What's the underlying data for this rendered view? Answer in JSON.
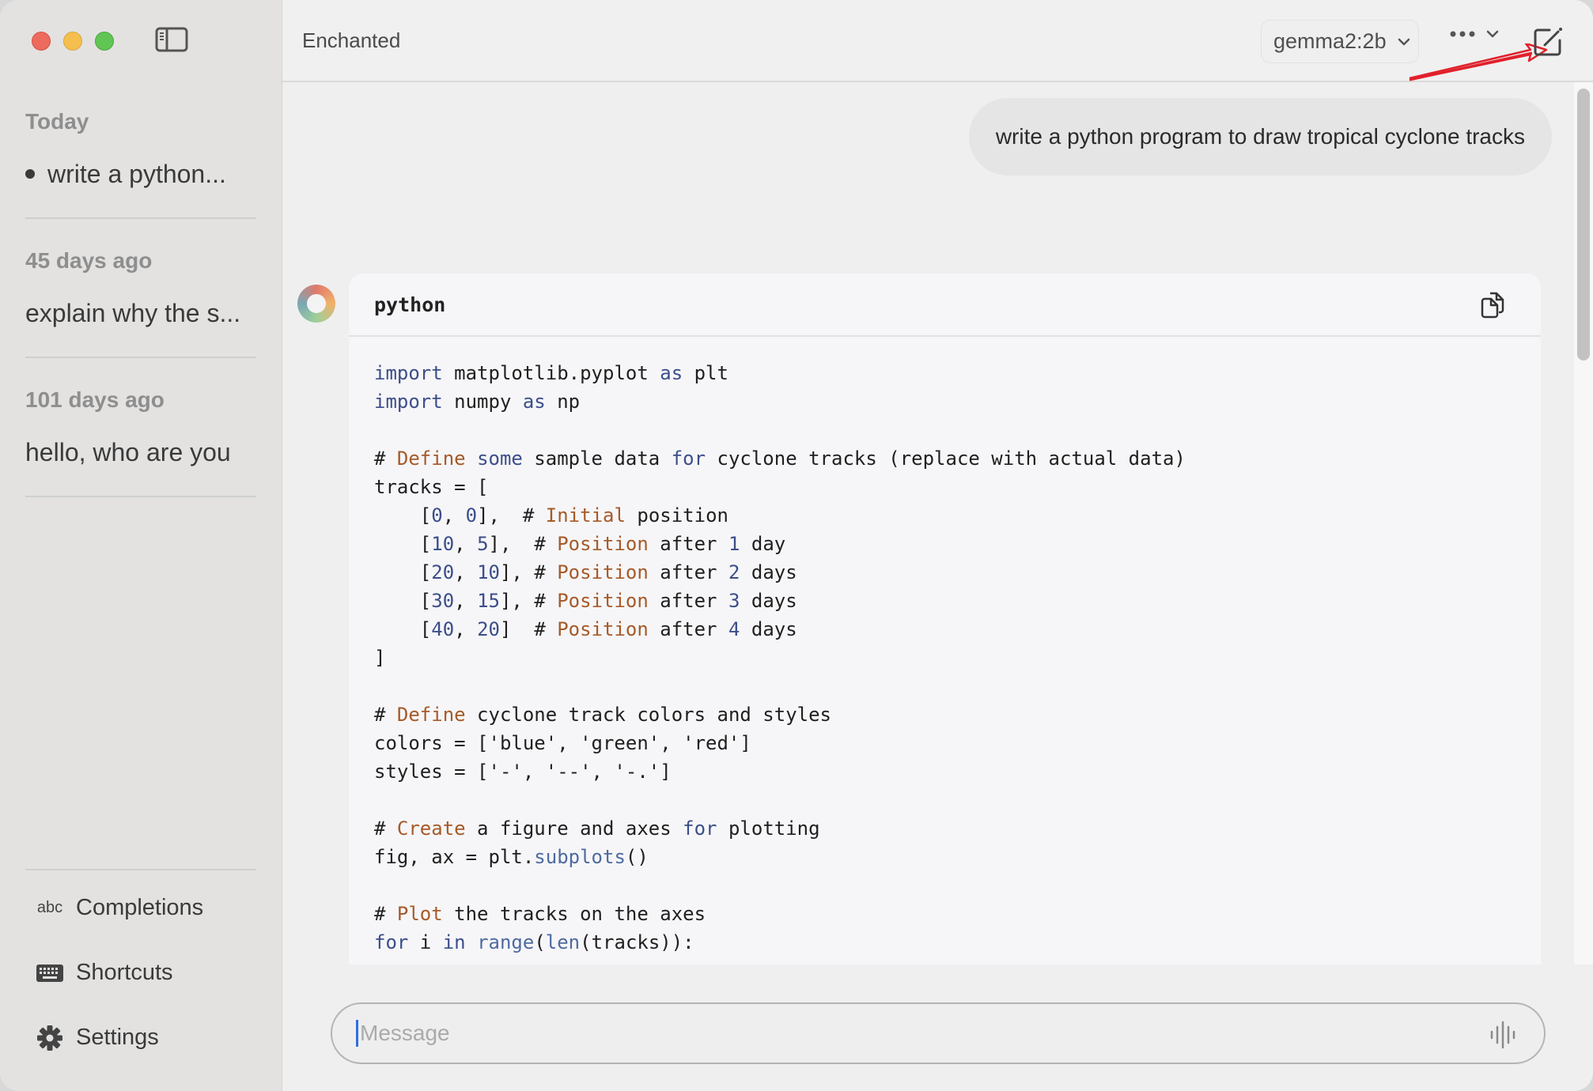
{
  "window": {
    "app_title": "Enchanted"
  },
  "sidebar": {
    "sections": [
      {
        "label": "Today",
        "items": [
          {
            "title": "write a python...",
            "active": true
          }
        ]
      },
      {
        "label": "45 days ago",
        "items": [
          {
            "title": "explain why the s...",
            "active": false
          }
        ]
      },
      {
        "label": "101 days ago",
        "items": [
          {
            "title": "hello, who are you",
            "active": false
          }
        ]
      }
    ],
    "bottom": [
      {
        "label": "Completions",
        "icon": "abc-icon",
        "icon_text": "abc"
      },
      {
        "label": "Shortcuts",
        "icon": "keyboard-icon"
      },
      {
        "label": "Settings",
        "icon": "gear-icon"
      }
    ]
  },
  "header": {
    "model": "gemma2:2b",
    "more_icon": "ellipsis-icon",
    "new_chat_icon": "compose-icon"
  },
  "chat": {
    "user_message": "write a python program to draw tropical cyclone tracks",
    "code_block": {
      "language": "python",
      "copy_icon": "copy-icon",
      "lines": [
        [
          [
            "kw",
            "import"
          ],
          [
            "t",
            " matplotlib.pyplot "
          ],
          [
            "kw",
            "as"
          ],
          [
            "t",
            " plt"
          ]
        ],
        [
          [
            "kw",
            "import"
          ],
          [
            "t",
            " numpy "
          ],
          [
            "kw",
            "as"
          ],
          [
            "t",
            " np"
          ]
        ],
        [],
        [
          [
            "t",
            "# "
          ],
          [
            "cm",
            "Define"
          ],
          [
            "t",
            " "
          ],
          [
            "kw",
            "some"
          ],
          [
            "t",
            " sample data "
          ],
          [
            "kw",
            "for"
          ],
          [
            "t",
            " cyclone tracks (replace with actual data)"
          ]
        ],
        [
          [
            "t",
            "tracks = ["
          ]
        ],
        [
          [
            "t",
            "    ["
          ],
          [
            "nm",
            "0"
          ],
          [
            "t",
            ", "
          ],
          [
            "nm",
            "0"
          ],
          [
            "t",
            "],  # "
          ],
          [
            "cm",
            "Initial"
          ],
          [
            "t",
            " position"
          ]
        ],
        [
          [
            "t",
            "    ["
          ],
          [
            "nm",
            "10"
          ],
          [
            "t",
            ", "
          ],
          [
            "nm",
            "5"
          ],
          [
            "t",
            "],  # "
          ],
          [
            "cm",
            "Position"
          ],
          [
            "t",
            " after "
          ],
          [
            "nm",
            "1"
          ],
          [
            "t",
            " day"
          ]
        ],
        [
          [
            "t",
            "    ["
          ],
          [
            "nm",
            "20"
          ],
          [
            "t",
            ", "
          ],
          [
            "nm",
            "10"
          ],
          [
            "t",
            "], # "
          ],
          [
            "cm",
            "Position"
          ],
          [
            "t",
            " after "
          ],
          [
            "nm",
            "2"
          ],
          [
            "t",
            " days"
          ]
        ],
        [
          [
            "t",
            "    ["
          ],
          [
            "nm",
            "30"
          ],
          [
            "t",
            ", "
          ],
          [
            "nm",
            "15"
          ],
          [
            "t",
            "], # "
          ],
          [
            "cm",
            "Position"
          ],
          [
            "t",
            " after "
          ],
          [
            "nm",
            "3"
          ],
          [
            "t",
            " days"
          ]
        ],
        [
          [
            "t",
            "    ["
          ],
          [
            "nm",
            "40"
          ],
          [
            "t",
            ", "
          ],
          [
            "nm",
            "20"
          ],
          [
            "t",
            "]  # "
          ],
          [
            "cm",
            "Position"
          ],
          [
            "t",
            " after "
          ],
          [
            "nm",
            "4"
          ],
          [
            "t",
            " days"
          ]
        ],
        [
          [
            "t",
            "]"
          ]
        ],
        [],
        [
          [
            "t",
            "# "
          ],
          [
            "cm",
            "Define"
          ],
          [
            "t",
            " cyclone track colors and styles"
          ]
        ],
        [
          [
            "t",
            "colors = ['blue', 'green', 'red']"
          ]
        ],
        [
          [
            "t",
            "styles = ['-', '--', '-.']"
          ]
        ],
        [],
        [
          [
            "t",
            "# "
          ],
          [
            "cm",
            "Create"
          ],
          [
            "t",
            " a figure and axes "
          ],
          [
            "kw",
            "for"
          ],
          [
            "t",
            " plotting"
          ]
        ],
        [
          [
            "t",
            "fig, ax = plt."
          ],
          [
            "fn",
            "subplots"
          ],
          [
            "t",
            "()"
          ]
        ],
        [],
        [
          [
            "t",
            "# "
          ],
          [
            "cm",
            "Plot"
          ],
          [
            "t",
            " the tracks on the axes"
          ]
        ],
        [
          [
            "kw",
            "for"
          ],
          [
            "t",
            " i "
          ],
          [
            "kw",
            "in"
          ],
          [
            "t",
            " "
          ],
          [
            "fn",
            "range"
          ],
          [
            "t",
            "("
          ],
          [
            "fn",
            "len"
          ],
          [
            "t",
            "(tracks)):"
          ]
        ]
      ]
    }
  },
  "composer": {
    "placeholder": "Message",
    "value": "",
    "voice_icon": "waveform-icon"
  },
  "colors": {
    "accent_caret": "#2f6fe0",
    "annotation_arrow": "#e0212b",
    "code_keyword": "#3c4e8a",
    "code_comment_word": "#a65a28"
  }
}
